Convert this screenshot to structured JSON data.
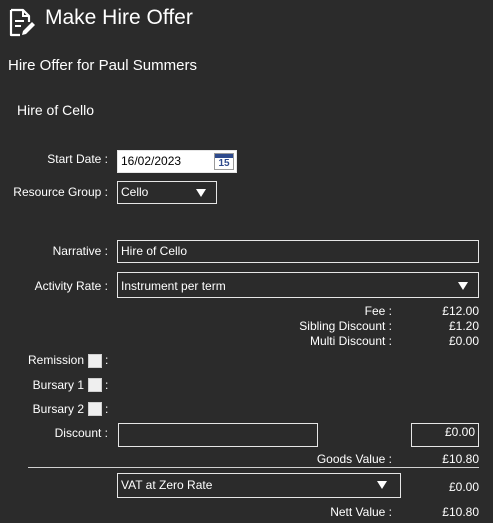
{
  "header": {
    "title": "Make Hire Offer",
    "icon": "document-edit-icon"
  },
  "subtitle": "Hire Offer for Paul Summers",
  "section_title": "Hire of Cello",
  "form": {
    "start_date": {
      "label": "Start Date :",
      "value": "16/02/2023",
      "calendar_day": "15"
    },
    "resource_group": {
      "label": "Resource Group :",
      "value": "Cello"
    },
    "narrative": {
      "label": "Narrative :",
      "value": "Hire of Cello"
    },
    "activity_rate": {
      "label": "Activity Rate :",
      "value": "Instrument per term"
    }
  },
  "totals": {
    "fee": {
      "label": "Fee :",
      "value": "£12.00"
    },
    "sibling_discount": {
      "label": "Sibling Discount :",
      "value": "£1.20"
    },
    "multi_discount": {
      "label": "Multi Discount :",
      "value": "£0.00"
    }
  },
  "checkboxes": {
    "remission": {
      "label": "Remission",
      "colon": ":",
      "checked": false
    },
    "bursary1": {
      "label": "Bursary 1",
      "colon": ":",
      "checked": false
    },
    "bursary2": {
      "label": "Bursary 2",
      "colon": ":",
      "checked": false
    }
  },
  "discount": {
    "label": "Discount :",
    "text_value": "",
    "amount": "£0.00"
  },
  "goods_value": {
    "label": "Goods Value :",
    "value": "£10.80"
  },
  "vat": {
    "select_value": "VAT at Zero Rate",
    "amount": "£0.00"
  },
  "nett_value": {
    "label": "Nett Value :",
    "value": "£10.80"
  }
}
